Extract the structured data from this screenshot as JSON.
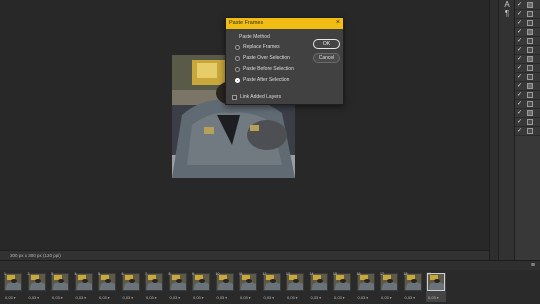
{
  "document": {
    "status": "300 px x 300 px (120 ppi)"
  },
  "dialog": {
    "title": "Paste Frames",
    "close_icon": "close-icon",
    "group_label": "Paste Method",
    "options": [
      {
        "label": "Replace Frames",
        "selected": false
      },
      {
        "label": "Paste Over Selection",
        "selected": false
      },
      {
        "label": "Paste Before Selection",
        "selected": false
      },
      {
        "label": "Paste After Selection",
        "selected": true
      }
    ],
    "link_layers_label": "Link Added Layers",
    "link_layers_checked": false,
    "ok_label": "OK",
    "cancel_label": "Cancel"
  },
  "timeline": {
    "menu_icon": "panel-menu-icon",
    "frames": [
      {
        "number": "1",
        "duration": "0,03"
      },
      {
        "number": "2",
        "duration": "0,03"
      },
      {
        "number": "3",
        "duration": "0,03"
      },
      {
        "number": "4",
        "duration": "0,03"
      },
      {
        "number": "5",
        "duration": "0,03"
      },
      {
        "number": "6",
        "duration": "0,03"
      },
      {
        "number": "7",
        "duration": "0,03"
      },
      {
        "number": "8",
        "duration": "0,03"
      },
      {
        "number": "9",
        "duration": "0,03"
      },
      {
        "number": "10",
        "duration": "0,03"
      },
      {
        "number": "11",
        "duration": "0,03"
      },
      {
        "number": "12",
        "duration": "0,03"
      },
      {
        "number": "13",
        "duration": "0,03"
      },
      {
        "number": "14",
        "duration": "0,03"
      },
      {
        "number": "15",
        "duration": "0,03"
      },
      {
        "number": "16",
        "duration": "0,03"
      },
      {
        "number": "17",
        "duration": "0,03"
      },
      {
        "number": "18",
        "duration": "0,03"
      },
      {
        "number": "19",
        "duration": "0,03"
      }
    ],
    "selected_frame": 19
  },
  "right_icons": [
    "character-panel-icon",
    "paragraph-panel-icon"
  ],
  "layers": {
    "rows": 15
  },
  "colors": {
    "dialog_titlebar": "#f2bd13",
    "workspace": "#282828",
    "panel": "#383838"
  }
}
